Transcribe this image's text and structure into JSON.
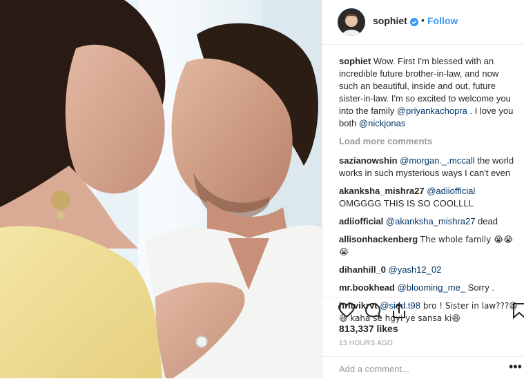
{
  "header": {
    "username": "sophiet",
    "dot": "•",
    "follow": "Follow",
    "verified_color": "#3897f0"
  },
  "caption": {
    "user": "sophiet",
    "text1": "Wow. First I'm blessed with an incredible future brother-in-law, and now such an beautiful, inside and out, future sister-in-law. I'm so excited to welcome you into the family ",
    "mention1": "@priyankachopra",
    "text2": " . I love you both ",
    "mention2": "@nickjonas"
  },
  "load_more": "Load more comments",
  "comments": [
    {
      "user": "sazianowshin",
      "mention": "@morgan._.mccall",
      "text": " the world works in such mysterious ways I can't even"
    },
    {
      "user": "akanksha_mishra27",
      "mention": "@adiiofficial",
      "text": " OMGGGG THIS IS SO COOLLLL"
    },
    {
      "user": "adiiofficial",
      "mention": "@akanksha_mishra27",
      "text": " dead"
    },
    {
      "user": "allisonhackenberg",
      "mention": "",
      "text": "The whole family 😭😭😭"
    },
    {
      "user": "dihanhill_0",
      "mention": "@yash12_02",
      "text": ""
    },
    {
      "user": "mr.bookhead",
      "mention": "@blooming_me_",
      "text": " Sorry ."
    },
    {
      "user": "hritvikrvt",
      "mention": "@sidd.t98",
      "text": " bro ! Sister in law???😆 😆 kaha se hgyi ye sansa ki😆"
    }
  ],
  "likes": "813,337 likes",
  "time_ago": "13 HOURS AGO",
  "add_comment_placeholder": "Add a comment...",
  "more_menu": "•••",
  "icons": {
    "like": "heart-icon",
    "comment": "comment-icon",
    "share": "share-icon",
    "save": "bookmark-icon"
  }
}
